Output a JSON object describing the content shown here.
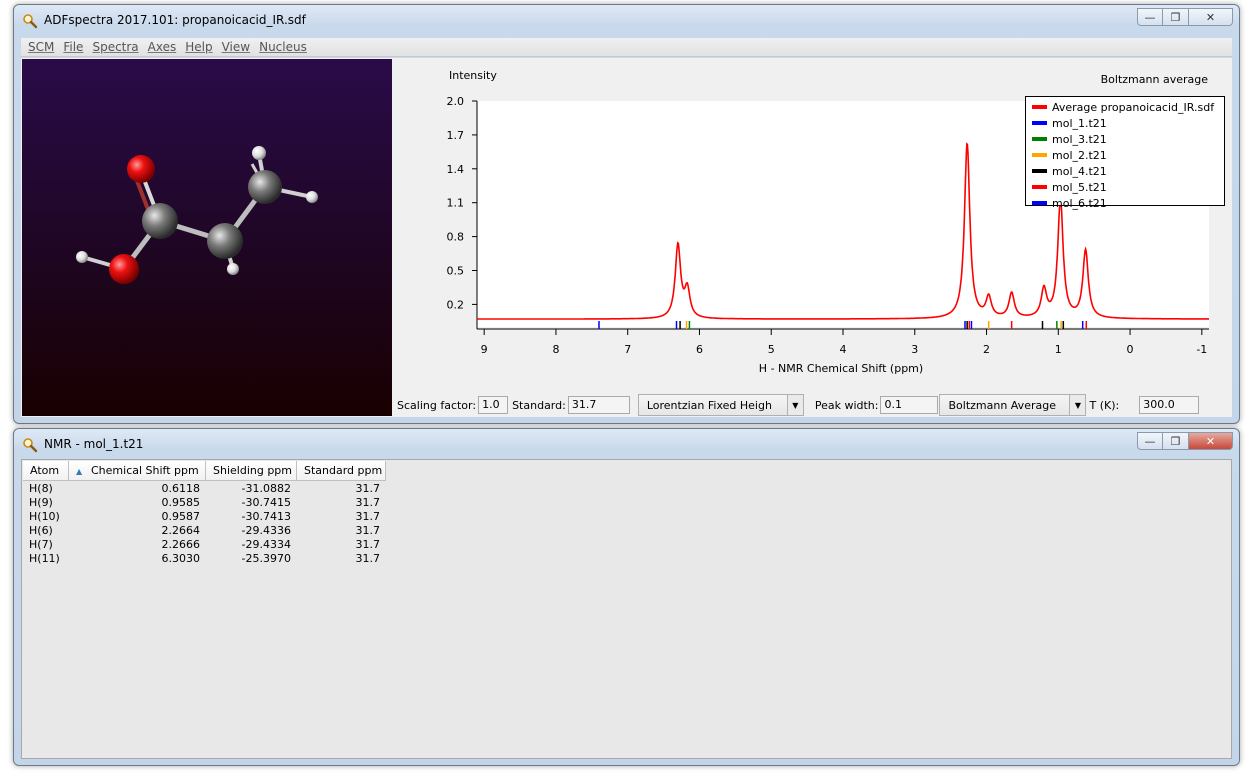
{
  "main_window": {
    "title": "ADFspectra 2017.101: propanoicacid_IR.sdf",
    "menu": [
      "SCM",
      "File",
      "Spectra",
      "Axes",
      "Help",
      "View",
      "Nucleus"
    ]
  },
  "spectrum": {
    "ylabel_top": "Intensity",
    "header_right": "Boltzmann average",
    "xlabel": "H - NMR Chemical Shift (ppm)",
    "legend": [
      {
        "label": "Average propanoicacid_IR.sdf",
        "color": "#ff0000"
      },
      {
        "label": "mol_1.t21",
        "color": "#0000ff"
      },
      {
        "label": "mol_3.t21",
        "color": "#008000"
      },
      {
        "label": "mol_2.t21",
        "color": "#ffa500"
      },
      {
        "label": "mol_4.t21",
        "color": "#000000"
      },
      {
        "label": "mol_5.t21",
        "color": "#ff0000"
      },
      {
        "label": "mol_6.t21",
        "color": "#0000ff"
      }
    ]
  },
  "chart_data": {
    "type": "line",
    "xlabel": "H - NMR Chemical Shift (ppm)",
    "ylabel": "Intensity",
    "xlim": [
      9.1,
      -1.1
    ],
    "ylim": [
      0,
      2.0
    ],
    "x_ticks": [
      9,
      8,
      7,
      6,
      5,
      4,
      3,
      2,
      1,
      0,
      -1
    ],
    "y_ticks": [
      0.2,
      0.5,
      0.8,
      1.1,
      1.4,
      1.7,
      2.0
    ],
    "y_tick_labels": [
      "0.2",
      "0.5",
      "0.8",
      "1.1",
      "1.4",
      "1.7",
      "2.0"
    ],
    "baseline": 0.07,
    "series": [
      {
        "name": "Average propanoicacid_IR.sdf",
        "color": "#ff0000",
        "peaks": [
          {
            "center": 6.3,
            "height": 0.65
          },
          {
            "center": 6.17,
            "height": 0.25
          },
          {
            "center": 2.27,
            "height": 1.55
          },
          {
            "center": 1.97,
            "height": 0.18
          },
          {
            "center": 1.65,
            "height": 0.22
          },
          {
            "center": 1.2,
            "height": 0.25
          },
          {
            "center": 0.97,
            "height": 1.05
          },
          {
            "center": 0.62,
            "height": 0.6
          }
        ]
      }
    ],
    "stick_markers": [
      {
        "x": 7.4,
        "color": "#0000ff"
      },
      {
        "x": 6.32,
        "color": "#0000ff"
      },
      {
        "x": 6.27,
        "color": "#000000"
      },
      {
        "x": 6.18,
        "color": "#ffa500"
      },
      {
        "x": 6.14,
        "color": "#008000"
      },
      {
        "x": 2.3,
        "color": "#0000ff"
      },
      {
        "x": 2.27,
        "color": "#000000"
      },
      {
        "x": 2.24,
        "color": "#ff0000"
      },
      {
        "x": 2.21,
        "color": "#0000ff"
      },
      {
        "x": 1.97,
        "color": "#ffa500"
      },
      {
        "x": 1.65,
        "color": "#ff0000"
      },
      {
        "x": 1.22,
        "color": "#000000"
      },
      {
        "x": 1.02,
        "color": "#008000"
      },
      {
        "x": 0.96,
        "color": "#ffa500"
      },
      {
        "x": 0.93,
        "color": "#000000"
      },
      {
        "x": 0.66,
        "color": "#0000ff"
      },
      {
        "x": 0.61,
        "color": "#ff0000"
      }
    ]
  },
  "controls": {
    "scaling_label": "Scaling factor:",
    "scaling_value": "1.0",
    "standard_label": "Standard:",
    "standard_value": "31.7",
    "lineshape": "Lorentzian Fixed Heigh",
    "peak_width_label": "Peak width:",
    "peak_width_value": "0.1",
    "averaging": "Boltzmann Average",
    "temp_label": "T (K):",
    "temp_value": "300.0"
  },
  "nmr_window": {
    "title": "NMR - mol_1.t21",
    "columns": [
      "Atom",
      "Chemical Shift ppm",
      "Shielding ppm",
      "Standard ppm"
    ],
    "rows": [
      [
        "H(8)",
        "0.6118",
        "-31.0882",
        "31.7"
      ],
      [
        "H(9)",
        "0.9585",
        "-30.7415",
        "31.7"
      ],
      [
        "H(10)",
        "0.9587",
        "-30.7413",
        "31.7"
      ],
      [
        "H(6)",
        "2.2664",
        "-29.4336",
        "31.7"
      ],
      [
        "H(7)",
        "2.2666",
        "-29.4334",
        "31.7"
      ],
      [
        "H(11)",
        "6.3030",
        "-25.3970",
        "31.7"
      ]
    ]
  },
  "icons": {
    "app": "magnifier-icon",
    "minimize": "minimize-icon",
    "maximize": "maximize-icon",
    "close": "close-icon",
    "sort": "sort-ascending-icon",
    "combo": "chevron-down-icon"
  },
  "colors": {
    "spectrum_line": "#ff0000",
    "molecule_bg_top": "#2a0b49",
    "molecule_bg_bottom": "#190000"
  }
}
